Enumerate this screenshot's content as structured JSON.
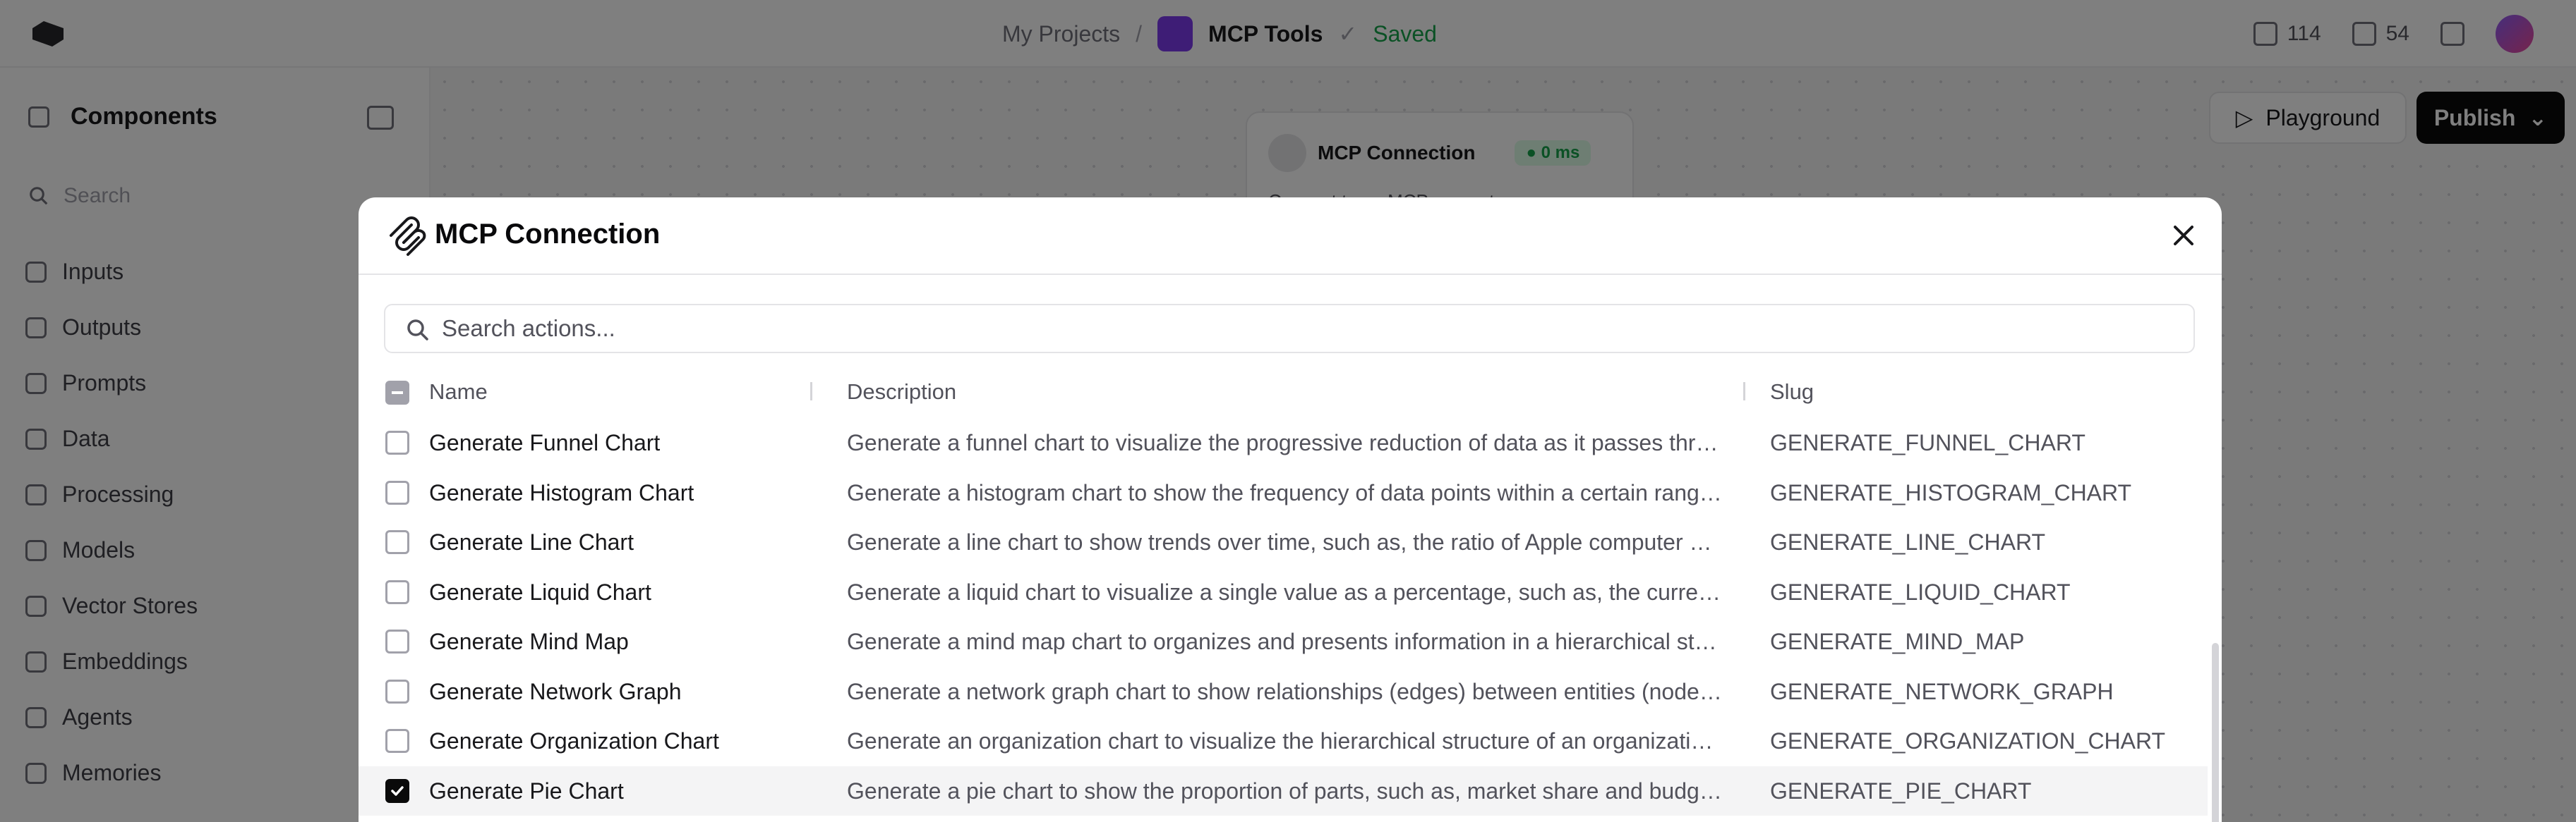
{
  "topbar": {
    "project_breadcrumb": "My Projects",
    "project_name": "MCP Tools",
    "save_status": "Saved",
    "stat_1": "114",
    "stat_2": "54"
  },
  "sidebar": {
    "title": "Components",
    "search_placeholder": "Search",
    "items": [
      {
        "label": "Inputs"
      },
      {
        "label": "Outputs"
      },
      {
        "label": "Prompts"
      },
      {
        "label": "Data"
      },
      {
        "label": "Processing"
      },
      {
        "label": "Models"
      },
      {
        "label": "Vector Stores"
      },
      {
        "label": "Embeddings"
      },
      {
        "label": "Agents"
      },
      {
        "label": "Memories"
      }
    ]
  },
  "canvas": {
    "node_title": "MCP Connection",
    "node_badge": "● 0 ms",
    "node_desc": "Connect to an MCP server to",
    "playground_label": "Playground",
    "publish_label": "Publish"
  },
  "modal": {
    "title": "MCP Connection",
    "search_placeholder": "Search actions...",
    "columns": {
      "name": "Name",
      "description": "Description",
      "slug": "Slug"
    },
    "rows": [
      {
        "name": "Generate Funnel Chart",
        "description": "Generate a funnel chart to visualize the progressive reduction of data as it passes throu...",
        "slug": "GENERATE_FUNNEL_CHART",
        "checked": false
      },
      {
        "name": "Generate Histogram Chart",
        "description": "Generate a histogram chart to show the frequency of data points within a certain range. ...",
        "slug": "GENERATE_HISTOGRAM_CHART",
        "checked": false
      },
      {
        "name": "Generate Line Chart",
        "description": "Generate a line chart to show trends over time, such as, the ratio of Apple computer sal...",
        "slug": "GENERATE_LINE_CHART",
        "checked": false
      },
      {
        "name": "Generate Liquid Chart",
        "description": "Generate a liquid chart to visualize a single value as a percentage, such as, the current o...",
        "slug": "GENERATE_LIQUID_CHART",
        "checked": false
      },
      {
        "name": "Generate Mind Map",
        "description": "Generate a mind map chart to organizes and presents information in a hierarchical struc...",
        "slug": "GENERATE_MIND_MAP",
        "checked": false
      },
      {
        "name": "Generate Network Graph",
        "description": "Generate a network graph chart to show relationships (edges) between entities (nodes),...",
        "slug": "GENERATE_NETWORK_GRAPH",
        "checked": false
      },
      {
        "name": "Generate Organization Chart",
        "description": "Generate an organization chart to visualize the hierarchical structure of an organization, ...",
        "slug": "GENERATE_ORGANIZATION_CHART",
        "checked": false
      },
      {
        "name": "Generate Pie Chart",
        "description": "Generate a pie chart to show the proportion of parts, such as, market share and budget ...",
        "slug": "GENERATE_PIE_CHART",
        "checked": true
      }
    ]
  }
}
